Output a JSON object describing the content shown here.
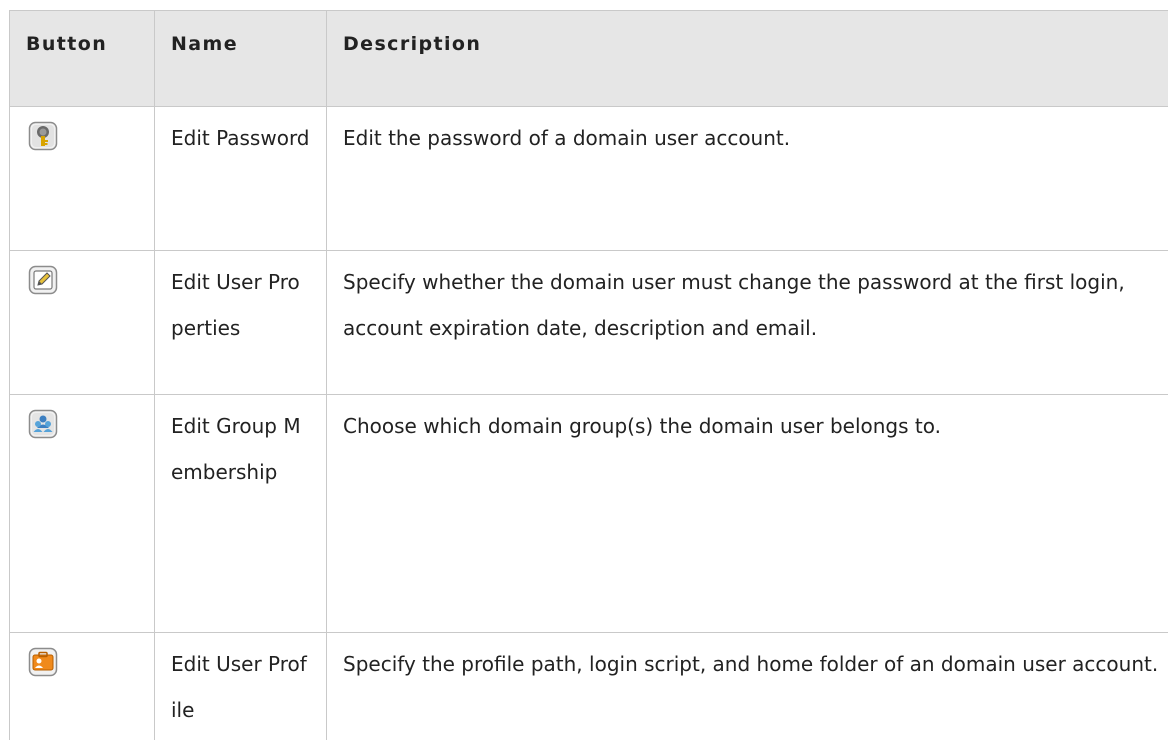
{
  "table": {
    "headers": {
      "button": "Button",
      "name": "Name",
      "description": "Description"
    },
    "rows": [
      {
        "icon": "key-icon",
        "name": "Edit Password",
        "description": "Edit the password of a domain user account."
      },
      {
        "icon": "edit-pencil-icon",
        "name": "Edit User Properties",
        "description": "Specify whether the domain user must change the password at the first login, account expiration date, description and email."
      },
      {
        "icon": "group-users-icon",
        "name": "Edit Group Membership",
        "description": "Choose which domain group(s) the domain user belongs to."
      },
      {
        "icon": "user-profile-icon",
        "name": "Edit User Profile",
        "description": "Specify the profile path, login script, and home folder of an domain user account."
      }
    ]
  },
  "colors": {
    "header_bg": "#e6e6e6",
    "border": "#c9c9c9",
    "text": "#222222"
  }
}
